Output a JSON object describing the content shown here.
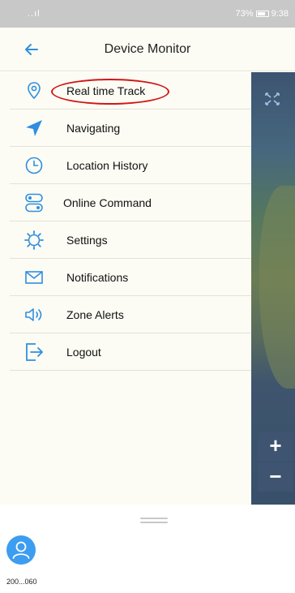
{
  "status_bar": {
    "signal": "..ıl",
    "right_text": "73%",
    "time": "9:38"
  },
  "header": {
    "title": "Device Monitor",
    "back_icon": "arrow-left-icon"
  },
  "menu": {
    "items": [
      {
        "label": "Real time Track",
        "icon": "location-pin-icon"
      },
      {
        "label": "Navigating",
        "icon": "navigation-arrow-icon"
      },
      {
        "label": "Location History",
        "icon": "clock-icon"
      },
      {
        "label": "Online Command",
        "icon": "command-icon"
      },
      {
        "label": "Settings",
        "icon": "gear-icon"
      },
      {
        "label": "Notifications",
        "icon": "envelope-icon"
      },
      {
        "label": "Zone Alerts",
        "icon": "speaker-icon"
      },
      {
        "label": "Logout",
        "icon": "logout-icon"
      }
    ]
  },
  "map": {
    "zoom_in": "+",
    "zoom_out": "−"
  },
  "device": {
    "label": "200...060",
    "avatar_icon": "person-icon"
  },
  "colors": {
    "accent": "#2f8fe0",
    "highlight": "#d01818",
    "drawer_bg": "#fcfcf4"
  }
}
